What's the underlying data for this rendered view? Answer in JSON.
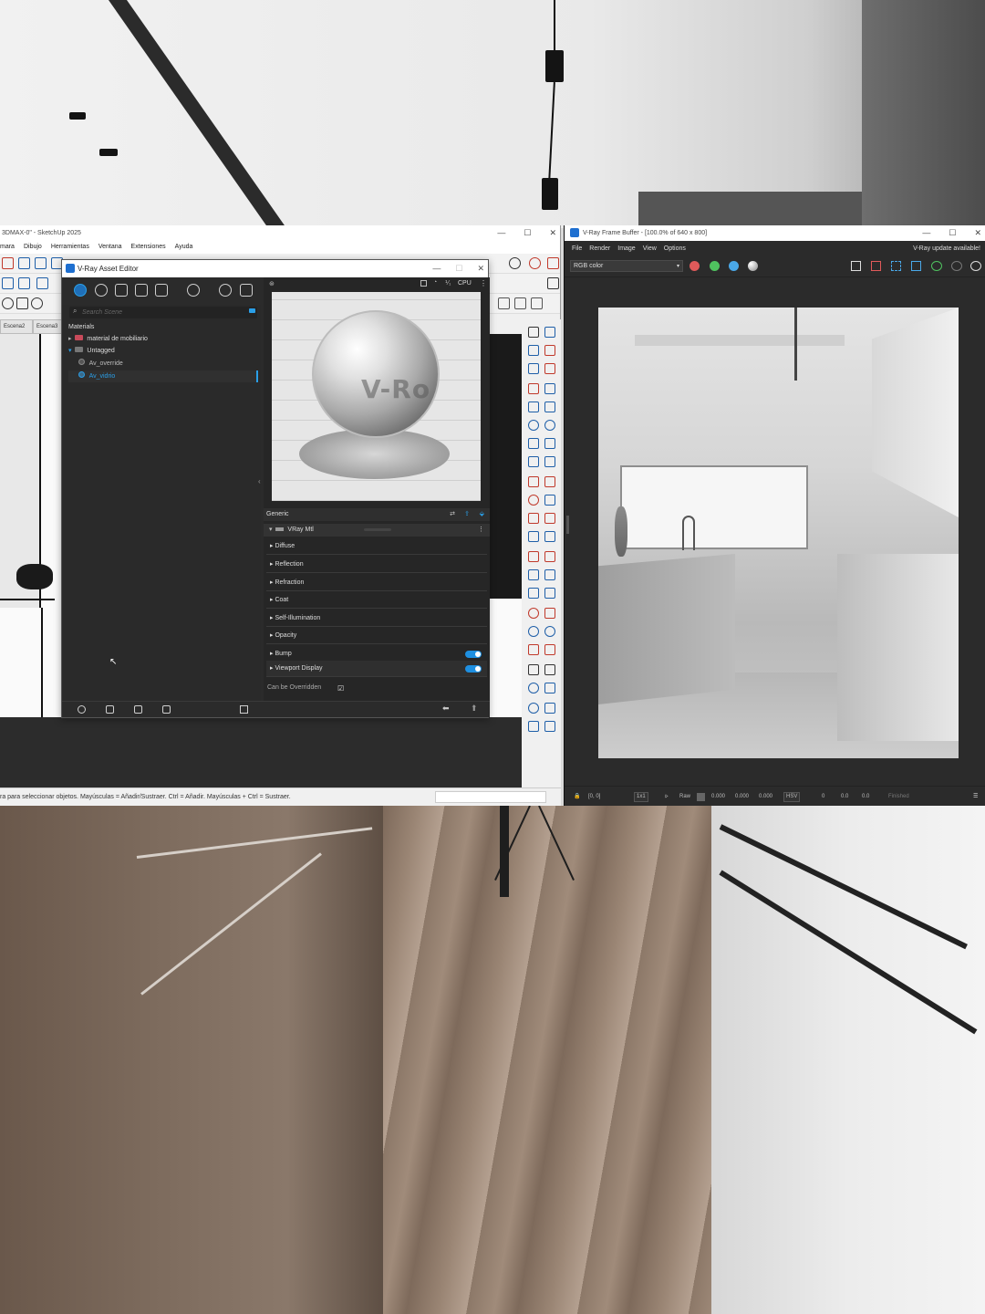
{
  "sketchup": {
    "title": "3DMAX-0\" - SketchUp 2025",
    "menu": [
      "mara",
      "Dibujo",
      "Herramientas",
      "Ventana",
      "Extensiones",
      "Ayuda"
    ],
    "tabs": [
      "Escena2",
      "Escena3"
    ],
    "status_text": "ra para seleccionar objetos. Mayúsculas = Añadir/Sustraer. Ctrl = Añadir. Mayúsculas + Ctrl = Sustraer."
  },
  "asset_editor": {
    "title": "V-Ray Asset Editor",
    "search_placeholder": "Search Scene",
    "tree": {
      "root": "Materials",
      "items": [
        {
          "label": "material de mobiliario",
          "type": "group"
        },
        {
          "label": "Untagged",
          "type": "group"
        },
        {
          "label": "Av_override",
          "type": "material"
        },
        {
          "label": "Av_vidrio",
          "type": "material",
          "selected": true
        }
      ]
    },
    "render_device": "CPU",
    "preview_watermark": "V-Ro",
    "generic_label": "Generic",
    "material_type": "VRay Mtl",
    "sections": [
      "Diffuse",
      "Reflection",
      "Refraction",
      "Coat",
      "Self-Illumination",
      "Opacity",
      "Bump",
      "Viewport Display"
    ],
    "toggles": {
      "Bump": true,
      "Viewport Display": true
    },
    "can_be_overridden_label": "Can be Overridden",
    "can_be_overridden": true
  },
  "frame_buffer": {
    "title": "V-Ray Frame Buffer - [100.0% of 640 x 800]",
    "menu": [
      "File",
      "Render",
      "Image",
      "View",
      "Options"
    ],
    "update_notice": "V-Ray update available!",
    "channel": "RGB color",
    "channel_dots": [
      "#e05a5a",
      "#4fc25f",
      "#4aa8e8"
    ],
    "status": {
      "coords": "[0, 0]",
      "zoom": "1x1",
      "raw_label": "Raw",
      "rgb_values": [
        "0.000",
        "0.000",
        "0.000"
      ],
      "mode": "HSV",
      "hsv_values": [
        "0",
        "0.0",
        "0.0"
      ],
      "state": "Finished"
    }
  },
  "icons": {
    "window_controls": [
      "minimize-icon",
      "maximize-icon",
      "close-icon"
    ],
    "accent": "#1e8fe0",
    "selected_text": "#2a9fe8"
  }
}
